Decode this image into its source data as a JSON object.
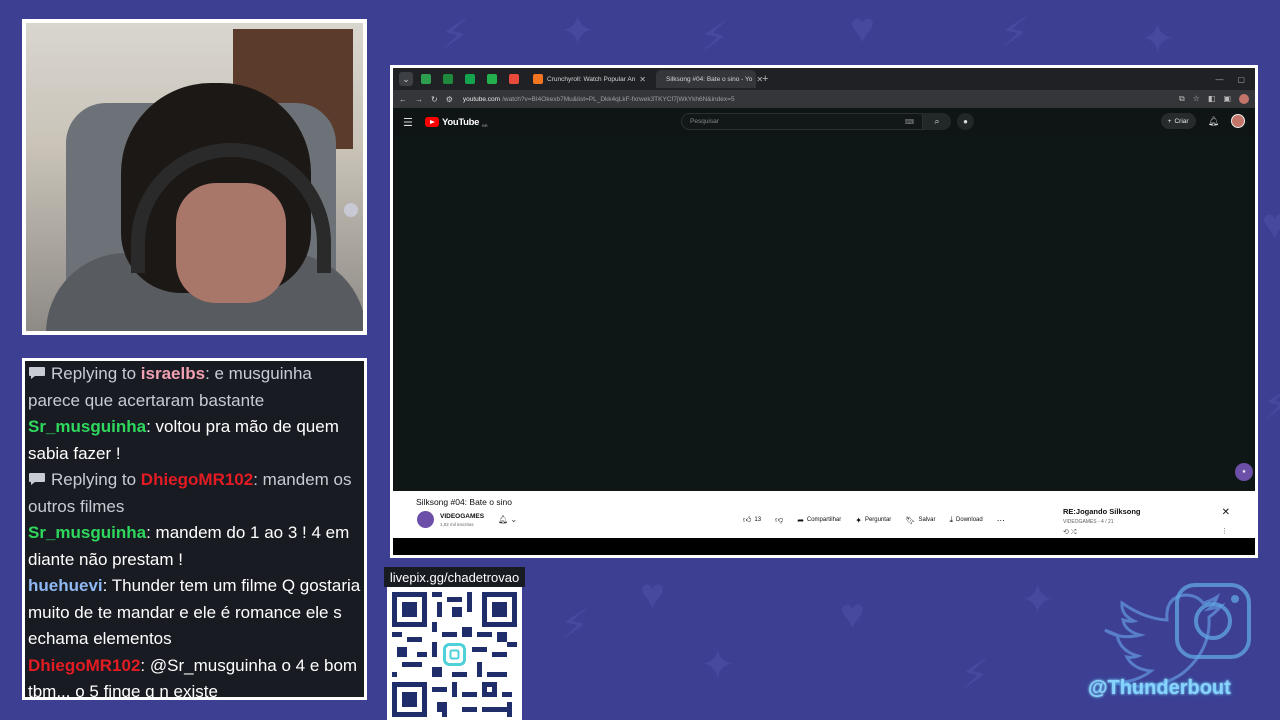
{
  "colors": {
    "background": "#3d3f93",
    "chat_bg": "#191b22",
    "user_green": "#2ed85d",
    "user_blue": "#8fb7f2",
    "user_red": "#e31b23",
    "yt_red": "#ff0000"
  },
  "chat": {
    "messages": [
      {
        "type": "reply",
        "reply_prefix": "Replying to",
        "reply_user": "israelbs",
        "text": ": e musguinha parece que acertaram bastante"
      },
      {
        "type": "msg",
        "user": "Sr_musguinha",
        "text": ": voltou pra mão de quem sabia fazer !"
      },
      {
        "type": "reply",
        "reply_prefix": "Replying to",
        "reply_user": "DhiegoMR102",
        "text": ": mandem os outros filmes"
      },
      {
        "type": "msg",
        "user": "Sr_musguinha",
        "text": ": mandem do 1 ao 3 ! 4 em diante não prestam !"
      },
      {
        "type": "msg",
        "user": "huehuevi",
        "text": ": Thunder tem um filme Q gostaria muito de te mandar e ele é romance ele s echama elementos"
      },
      {
        "type": "msg",
        "user": "DhiegoMR102",
        "text": ": @Sr_musguinha o 4 e bom tbm... o 5 finge q n existe"
      }
    ]
  },
  "browser": {
    "tabs": [
      {
        "label": "Crunchyroll: Watch Popular An",
        "active": false
      },
      {
        "label": "Silksong #04: Bate o sino - Yo",
        "active": true
      }
    ],
    "url_host": "youtube.com",
    "url_path": "/watch?v=BI4Okexb7Mu&list=PL_Dkk4qLkF-fxrwek3TKYCf7jWkYkh6N&index=5"
  },
  "youtube": {
    "logo_text": "YouTube",
    "region": "BR",
    "search_placeholder": "Pesquisar",
    "create_label": "Criar",
    "video_title": "Silksong #04: Bate o sino",
    "channel_name": "VIDEOGAMES",
    "channel_subs": "1,02 mil inscritos",
    "likes": "13",
    "actions": {
      "share": "Compartilhar",
      "ask": "Perguntar",
      "save": "Salvar",
      "download": "Download"
    },
    "playlist_title": "RE:Jogando Silksong",
    "playlist_sub": "VIDEOGAMES - 4 / 21"
  },
  "livepix": {
    "label": "livepix.gg/chadetrovao"
  },
  "social": {
    "handle": "@Thunderbout"
  }
}
